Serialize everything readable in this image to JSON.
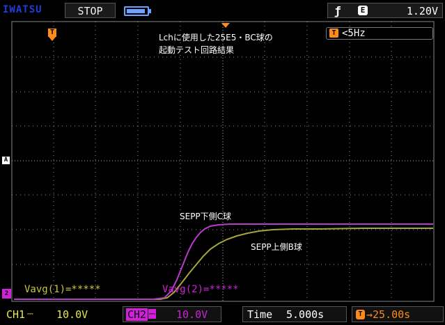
{
  "header": {
    "brand": "IWATSU",
    "run_state": "STOP",
    "trigger_source": "E",
    "trigger_level": "1.20V"
  },
  "screen": {
    "title_line1": "Lchに使用した25E5・BC球の",
    "title_line2": "起動テスト回路結果",
    "freq_readout": "<5Hz",
    "trace_label_ch2": "SEPP下側C球",
    "trace_label_ch1": "SEPP上側B球",
    "vavg1": "Vavg(1)=*****",
    "vavg2": "Vavg(2)=*****"
  },
  "markers": {
    "trigger_marker": "T",
    "ch_a_marker": "A",
    "ch2_marker": "2"
  },
  "footer": {
    "ch1_label": "CH1",
    "ch1_scale": "10.0V",
    "ch2_label": "CH2",
    "ch2_scale": "10.0V",
    "time_label": "Time",
    "time_base": "5.000s",
    "trig_pos": "→25.00s"
  },
  "colors": {
    "ch1_trace": "#a6a63a",
    "ch2_trace": "#b63dc8",
    "trigger_accent": "#ff8c1a",
    "brand": "#1e3fd8",
    "grid": "#9a9a9a"
  },
  "icons": {
    "battery": "battery-icon",
    "trigger_edge": "falling-edge-icon"
  }
}
